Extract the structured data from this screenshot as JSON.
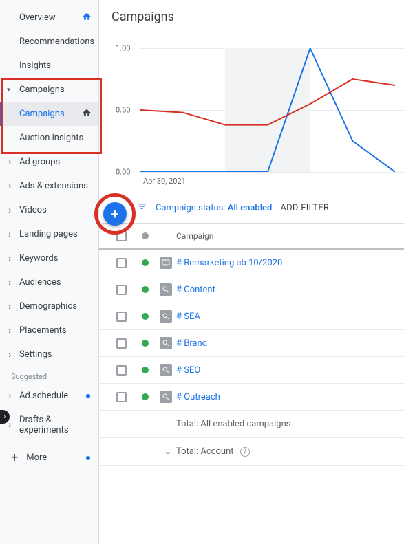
{
  "sidebar": {
    "overview": "Overview",
    "recommendations": "Recommendations",
    "insights": "Insights",
    "campaigns": "Campaigns",
    "campaigns_sub": "Campaigns",
    "auction_insights": "Auction insights",
    "ad_groups": "Ad groups",
    "ads_ext": "Ads & extensions",
    "videos": "Videos",
    "landing": "Landing pages",
    "keywords": "Keywords",
    "audiences": "Audiences",
    "demographics": "Demographics",
    "placements": "Placements",
    "settings": "Settings",
    "suggested": "Suggested",
    "ad_schedule": "Ad schedule",
    "drafts": "Drafts & experiments",
    "more": "More"
  },
  "header": {
    "title": "Campaigns"
  },
  "chart_data": {
    "type": "line",
    "x": [
      "Apr 30, 2021"
    ],
    "ylim": [
      0,
      1.0
    ],
    "yticks": [
      0.0,
      0.5,
      1.0
    ],
    "series": [
      {
        "name": "blue",
        "color": "#1a73e8",
        "values": [
          0.0,
          0.0,
          0.0,
          0.0,
          1.0,
          0.25,
          0.0
        ]
      },
      {
        "name": "red",
        "color": "#d93025",
        "values": [
          0.5,
          0.48,
          0.38,
          0.38,
          0.55,
          0.75,
          0.7
        ]
      }
    ],
    "shaded_region": [
      2,
      4
    ],
    "xlabel": "Apr 30, 2021"
  },
  "filter": {
    "label": "Campaign status:",
    "value": "All enabled",
    "add": "ADD FILTER"
  },
  "table": {
    "header": "Campaign",
    "rows": [
      {
        "status": "green",
        "icon": "display",
        "name": "# Remarketing ab 10/2020"
      },
      {
        "status": "green",
        "icon": "search",
        "name": "# Content"
      },
      {
        "status": "green",
        "icon": "search",
        "name": "# SEA"
      },
      {
        "status": "green",
        "icon": "search",
        "name": "# Brand"
      },
      {
        "status": "green",
        "icon": "search",
        "name": "# SEO"
      },
      {
        "status": "green",
        "icon": "search",
        "name": "# Outreach"
      }
    ],
    "total1": "Total: All enabled campaigns",
    "total2": "Total: Account"
  }
}
